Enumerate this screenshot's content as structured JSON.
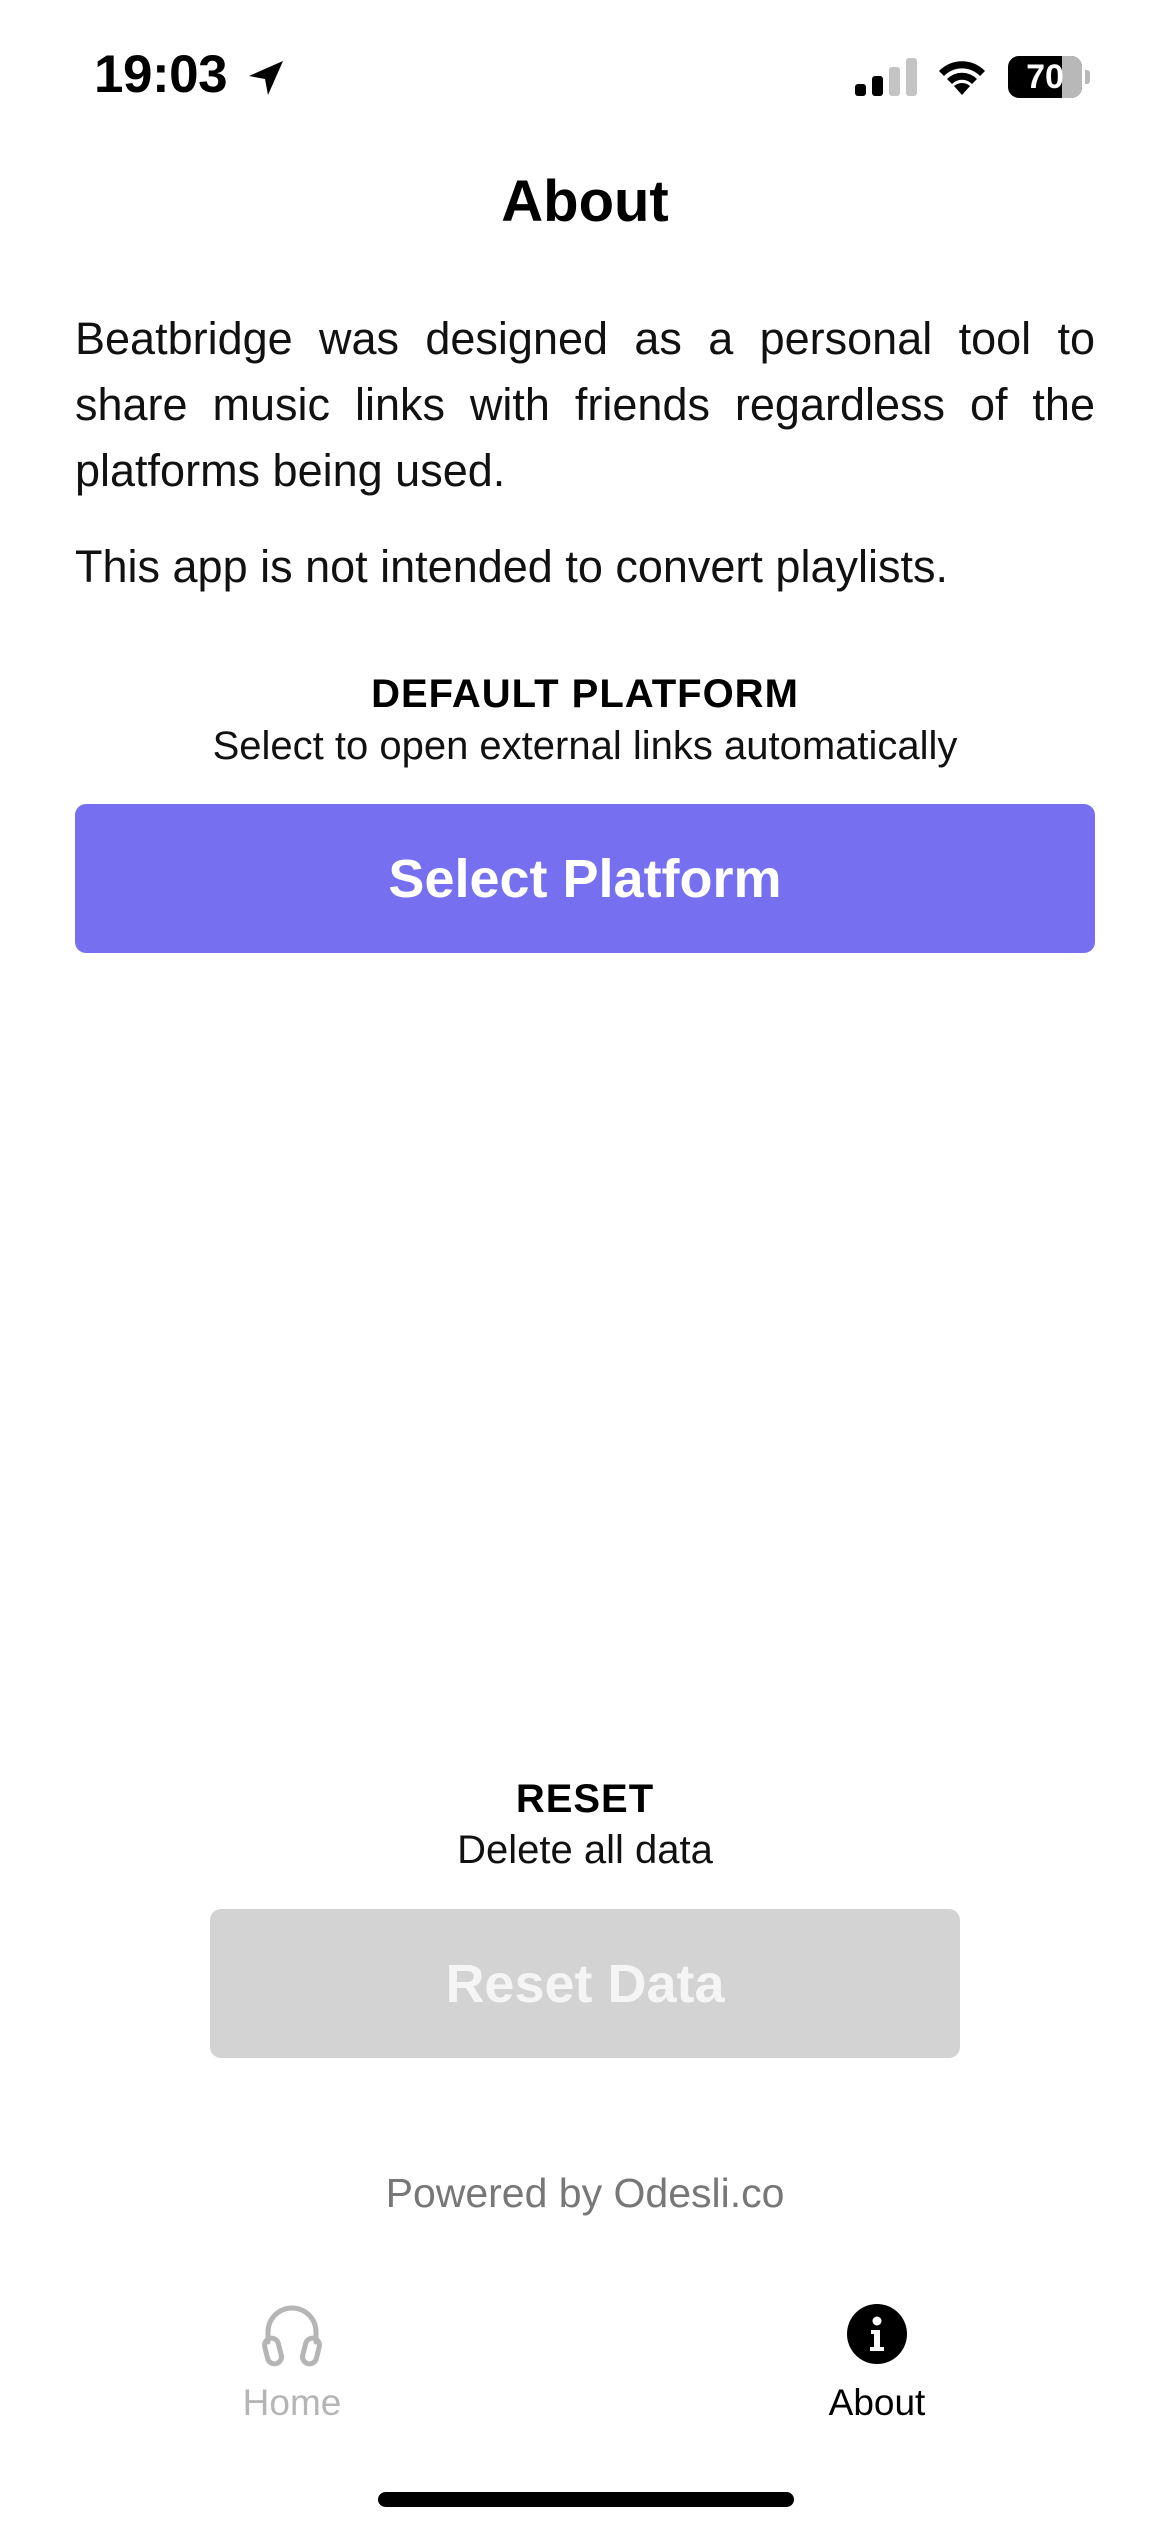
{
  "status_bar": {
    "time": "19:03",
    "battery_level": "70",
    "icons": [
      "location-arrow-icon",
      "cellular-signal-icon",
      "wifi-icon",
      "battery-icon"
    ]
  },
  "header": {
    "title": "About"
  },
  "description": {
    "paragraph_1": "Beatbridge was designed as a personal tool to share music links with friends regardless of the platforms being used.",
    "paragraph_2": "This app is not intended to convert playlists."
  },
  "default_platform": {
    "heading": "DEFAULT PLATFORM",
    "subtitle": "Select to open external links automatically",
    "button_label": "Select Platform",
    "button_color": "#7670f0"
  },
  "reset": {
    "heading": "RESET",
    "subtitle": "Delete all data",
    "button_label": "Reset Data",
    "button_color": "#d3d3d3",
    "button_disabled": true
  },
  "footer": {
    "powered_by": "Powered by Odesli.co"
  },
  "tab_bar": {
    "tabs": [
      {
        "label": "Home",
        "icon": "headphones-icon",
        "active": false
      },
      {
        "label": "About",
        "icon": "info-circle-icon",
        "active": true
      }
    ]
  }
}
